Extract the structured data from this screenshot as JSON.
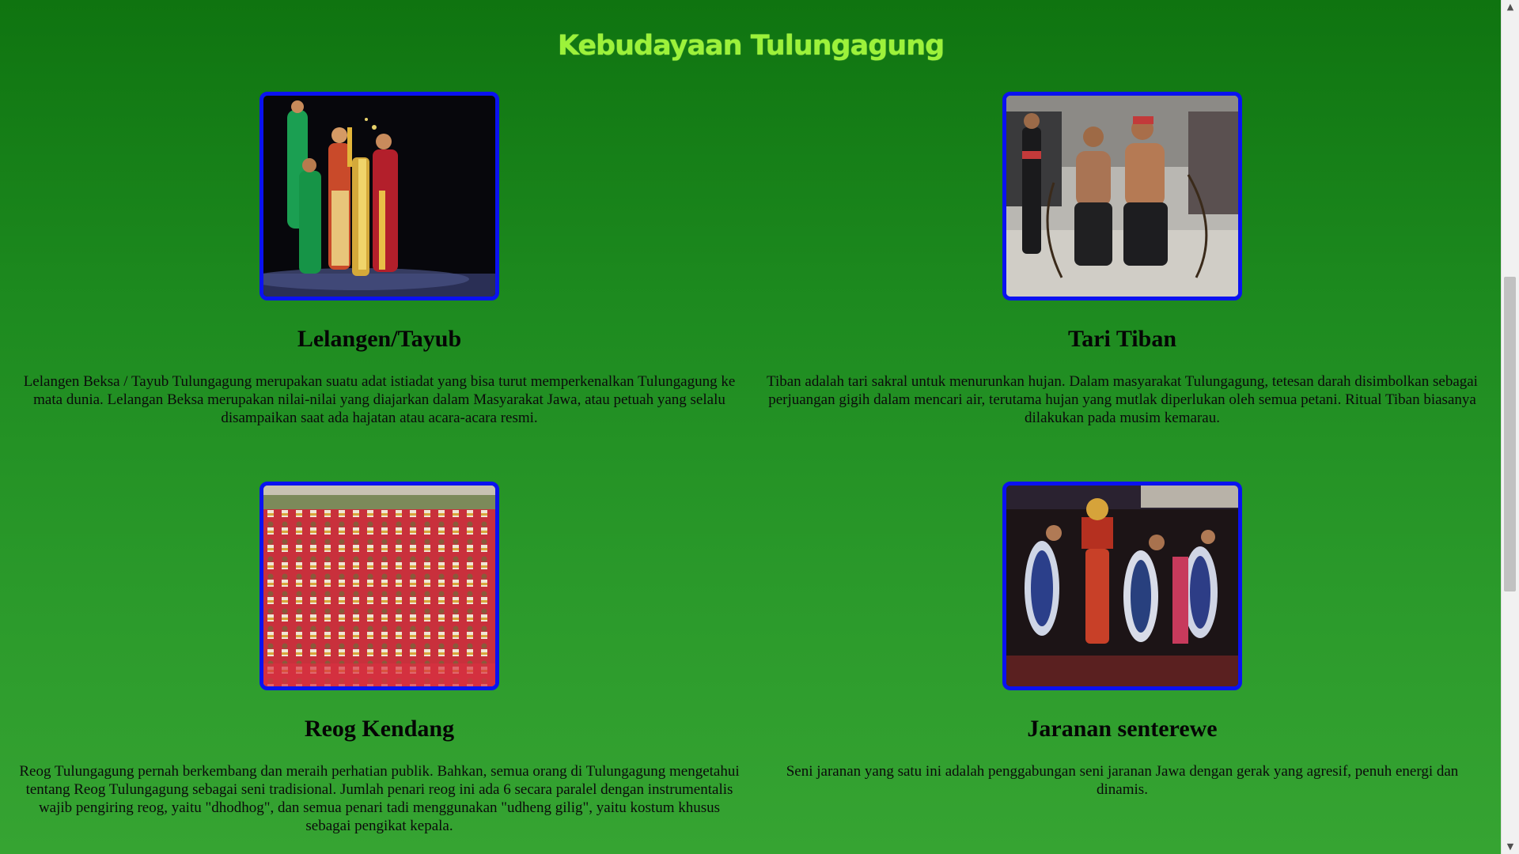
{
  "page": {
    "title": "Kebudayaan Tulungagung"
  },
  "colors": {
    "background": "#1d8a1f",
    "title": "#9cf23a",
    "image_border": "#0a12f0"
  },
  "cards": [
    {
      "heading": "Lelangen/Tayub",
      "description": "Lelangen Beksa / Tayub Tulungagung merupakan suatu adat istiadat yang bisa turut memperkenalkan Tulungagung ke mata dunia. Lelangan Beksa merupakan nilai-nilai yang diajarkan dalam Masyarakat Jawa, atau petuah yang selalu disampaikan saat ada hajatan atau acara-acara resmi."
    },
    {
      "heading": "Tari Tiban",
      "description": "Tiban adalah tari sakral untuk menurunkan hujan. Dalam masyarakat Tulungagung, tetesan darah disimbolkan sebagai perjuangan gigih dalam mencari air, terutama hujan yang mutlak diperlukan oleh semua petani. Ritual Tiban biasanya dilakukan pada musim kemarau."
    },
    {
      "heading": "Reog Kendang",
      "description": "Reog Tulungagung pernah berkembang dan meraih perhatian publik. Bahkan, semua orang di Tulungagung mengetahui tentang Reog Tulungagung sebagai seni tradisional. Jumlah penari reog ini ada 6 secara paralel dengan instrumentalis wajib pengiring reog, yaitu \"dhodhog\", dan semua penari tadi menggunakan \"udheng gilig\", yaitu kostum khusus sebagai pengikat kepala."
    },
    {
      "heading": "Jaranan senterewe",
      "description": "Seni jaranan yang satu ini adalah penggabungan seni jaranan Jawa dengan gerak yang agresif, penuh energi dan dinamis."
    }
  ],
  "scrollbar": {
    "up_arrow": "▲",
    "down_arrow": "▼"
  }
}
